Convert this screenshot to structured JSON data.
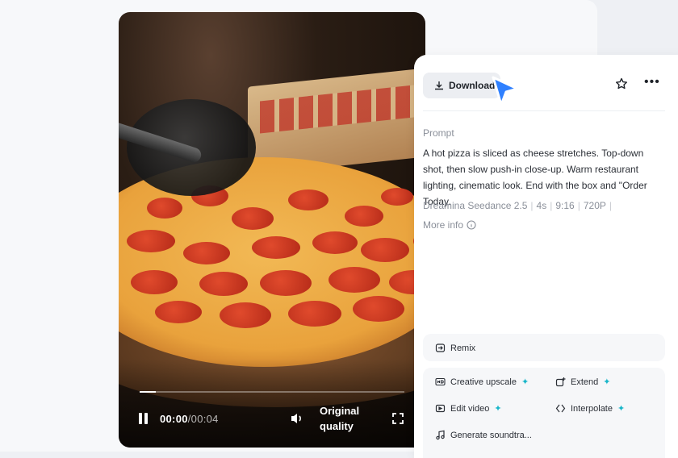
{
  "video": {
    "progress": 0.06,
    "time_current": "00:00",
    "time_separator": "/",
    "time_total": "00:04",
    "quality_line1": "Original",
    "quality_line2": "quality"
  },
  "panel": {
    "download_label": "Download",
    "prompt_label": "Prompt",
    "prompt_text": "A hot pizza is sliced as cheese stretches. Top-down shot, then slow push-in close-up. Warm restaurant lighting, cinematic look. End with the box and \"Order Today.",
    "meta": {
      "model": "Dreamina Seedance 2.5",
      "duration": "4s",
      "ratio": "9:16",
      "resolution": "720P"
    },
    "more_info": "More info",
    "remix": "Remix",
    "actions": {
      "creative_upscale": "Creative upscale",
      "extend": "Extend",
      "edit_video": "Edit video",
      "interpolate": "Interpolate",
      "generate_soundtrack": "Generate soundtra..."
    },
    "accent_color": "#19b6c9"
  }
}
